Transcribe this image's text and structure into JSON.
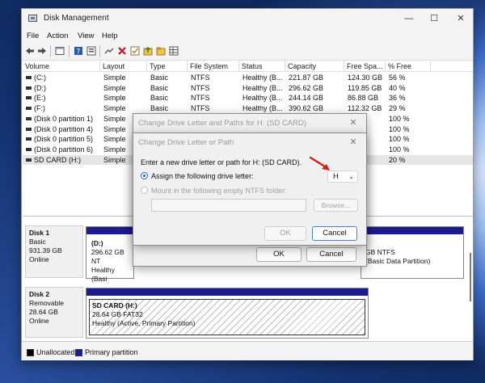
{
  "window": {
    "title": "Disk Management",
    "menu": [
      "File",
      "Action",
      "View",
      "Help"
    ],
    "controls": {
      "minimize": "—",
      "maximize": "☐",
      "close": "✕"
    }
  },
  "columns": [
    "Volume",
    "Layout",
    "Type",
    "File System",
    "Status",
    "Capacity",
    "Free Spa...",
    "% Free"
  ],
  "volumes": [
    {
      "volume": "(C:)",
      "layout": "Simple",
      "type": "Basic",
      "fs": "NTFS",
      "status": "Healthy (B...",
      "capacity": "221.87 GB",
      "free": "124.30 GB",
      "pct": "56 %"
    },
    {
      "volume": "(D:)",
      "layout": "Simple",
      "type": "Basic",
      "fs": "NTFS",
      "status": "Healthy (B...",
      "capacity": "296.62 GB",
      "free": "119.85 GB",
      "pct": "40 %"
    },
    {
      "volume": "(E:)",
      "layout": "Simple",
      "type": "Basic",
      "fs": "NTFS",
      "status": "Healthy (B...",
      "capacity": "244.14 GB",
      "free": "86.88 GB",
      "pct": "36 %"
    },
    {
      "volume": "(F:)",
      "layout": "Simple",
      "type": "Basic",
      "fs": "NTFS",
      "status": "Healthy (B...",
      "capacity": "390.62 GB",
      "free": "112.32 GB",
      "pct": "29 %"
    },
    {
      "volume": "(Disk 0 partition 1)",
      "layout": "Simple",
      "type": "Basic",
      "fs": "",
      "status": "",
      "capacity": "",
      "free": "MB",
      "pct": "100 %"
    },
    {
      "volume": "(Disk 0 partition 4)",
      "layout": "Simple",
      "type": "Basic",
      "fs": "",
      "status": "",
      "capacity": "",
      "free": "MB",
      "pct": "100 %"
    },
    {
      "volume": "(Disk 0 partition 5)",
      "layout": "Simple",
      "type": "Basic",
      "fs": "",
      "status": "",
      "capacity": "",
      "free": "MB",
      "pct": "100 %"
    },
    {
      "volume": "(Disk 0 partition 6)",
      "layout": "Simple",
      "type": "Basic",
      "fs": "",
      "status": "",
      "capacity": "",
      "free": "MB",
      "pct": "100 %"
    },
    {
      "volume": "SD CARD (H:)",
      "layout": "Simple",
      "type": "",
      "fs": "",
      "status": "",
      "capacity": "",
      "free": "GB",
      "pct": "20 %"
    }
  ],
  "disk1": {
    "name": "Disk 1",
    "type": "Basic",
    "size": "931.39 GB",
    "state": "Online",
    "part1_title": "(D:)",
    "part1_line": "296.62 GB NT",
    "part1_status": "Healthy (Basi",
    "part2_line": "GB NTFS",
    "part2_status": "(Basic Data Partition)"
  },
  "disk2": {
    "name": "Disk 2",
    "type": "Removable",
    "size": "28.64 GB",
    "state": "Online",
    "part_title": "SD CARD  (H:)",
    "part_line": "28.64 GB FAT32",
    "part_status": "Healthy (Active, Primary Partition)"
  },
  "legend": {
    "unallocated": "Unallocated",
    "primary": "Primary partition"
  },
  "dialog_outer": {
    "title": "Change Drive Letter and Paths for H: (SD CARD)",
    "ok": "OK",
    "cancel": "Cancel"
  },
  "dialog_inner": {
    "title": "Change Drive Letter or Path",
    "prompt": "Enter a new drive letter or path for H: (SD CARD).",
    "assign_label": "Assign the following drive letter:",
    "drive_letter": "H",
    "mount_label": "Mount in the following empty NTFS folder:",
    "browse": "Browse...",
    "ok": "OK",
    "cancel": "Cancel"
  },
  "colors": {
    "primary_partition": "#1c1c8c",
    "arrow": "#d21f1f"
  }
}
